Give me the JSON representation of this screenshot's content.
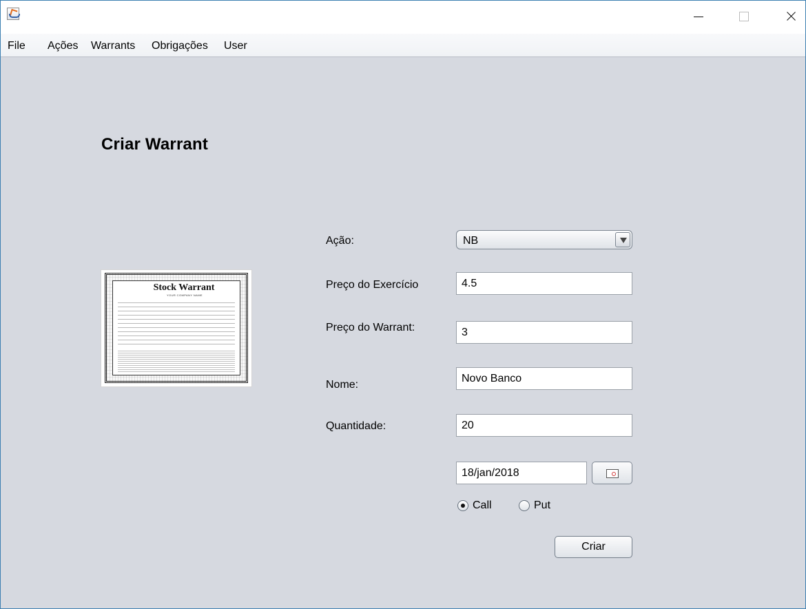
{
  "window": {
    "controls": [
      "minimize-icon",
      "maximize-icon",
      "close-icon"
    ]
  },
  "menu": [
    {
      "label": "File"
    },
    {
      "label": "Ações"
    },
    {
      "label": "Warrants"
    },
    {
      "label": "Obrigações"
    },
    {
      "label": "User"
    }
  ],
  "main": {
    "title": "Criar Warrant",
    "image": {
      "title": "Stock Warrant",
      "company": "YOUR COMPANY NAME"
    }
  },
  "form": {
    "acao": {
      "label": "Ação:",
      "selected": "NB"
    },
    "preco_exercicio": {
      "label": "Preço do Exercício",
      "value": "4.5"
    },
    "preco_warrant": {
      "label": "Preço do Warrant:",
      "value": "3"
    },
    "nome": {
      "label": "Nome:",
      "value": "Novo Banco"
    },
    "quantidade": {
      "label": "Quantidade:",
      "value": "20"
    },
    "data": {
      "value": "18/jan/2018"
    },
    "tipo": {
      "options": [
        {
          "label": "Call",
          "checked": true
        },
        {
          "label": "Put",
          "checked": false
        }
      ]
    },
    "submit_label": "Criar"
  }
}
